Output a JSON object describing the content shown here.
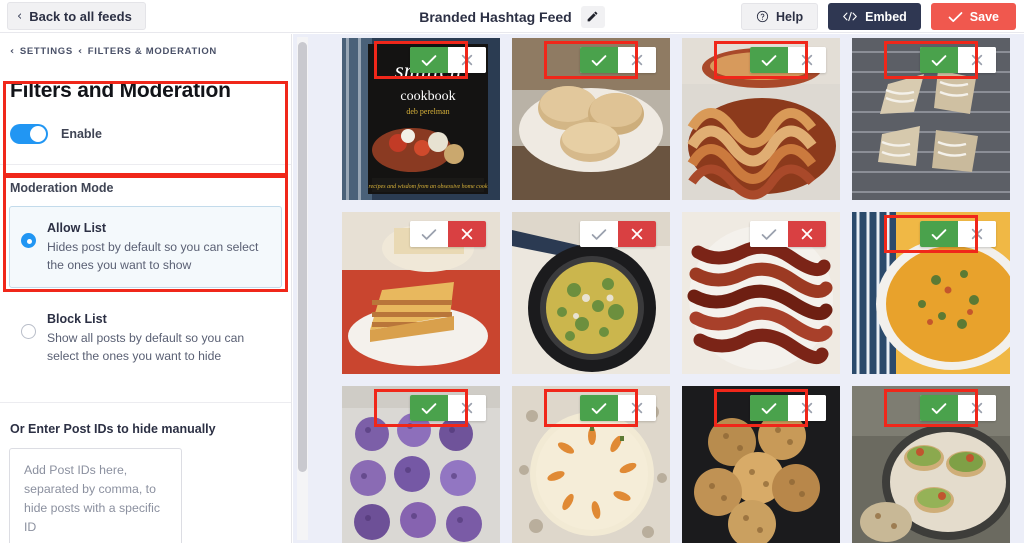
{
  "topbar": {
    "back_label": "Back to all feeds",
    "back_icon": "chevron-left-icon",
    "feed_title": "Branded Hashtag Feed",
    "edit_icon": "pencil-icon",
    "help_label": "Help",
    "help_icon": "question-circle-icon",
    "embed_label": "Embed",
    "embed_icon": "code-brackets-icon",
    "save_label": "Save",
    "save_icon": "check-icon"
  },
  "sidebar": {
    "breadcrumb": {
      "sep_icon": "chevron-left-icon",
      "items": [
        "SETTINGS",
        "FILTERS & MODERATION"
      ]
    },
    "panel_title": "Filters and Moderation",
    "enable": {
      "label": "Enable",
      "state": "on"
    },
    "moderation_mode": {
      "label": "Moderation Mode",
      "options": [
        {
          "title": "Allow List",
          "description": "Hides post by default so you can select the ones you want to show",
          "selected": true
        },
        {
          "title": "Block List",
          "description": "Show all posts by default so you can select the ones you want to hide",
          "selected": false
        }
      ]
    },
    "post_ids": {
      "label": "Or Enter Post IDs to hide manually",
      "value": "",
      "placeholder": "Add Post IDs here, separated by comma, to hide posts with a specific ID"
    }
  },
  "moderation_grid": {
    "check_icon": "check-icon",
    "x_icon": "close-x-icon",
    "columns": 4,
    "posts": [
      {
        "id": 1,
        "caption": "smitten kitchen cookbook",
        "state": "allowed",
        "annotated": true,
        "palette": [
          "#1c1b19",
          "#2a2d38",
          "#c23b26",
          "#d8d3c6"
        ]
      },
      {
        "id": 2,
        "caption": "biscuits on plate",
        "state": "allowed",
        "annotated": true,
        "palette": [
          "#d9c6a6",
          "#c5a575",
          "#efe8df",
          "#8a6a46"
        ]
      },
      {
        "id": 3,
        "caption": "babka swirl loaf",
        "state": "allowed",
        "annotated": true,
        "palette": [
          "#d9d6d1",
          "#a9492a",
          "#e0b47a",
          "#7a3318"
        ]
      },
      {
        "id": 4,
        "caption": "scones with icing on rack",
        "state": "allowed",
        "annotated": true,
        "palette": [
          "#5e6167",
          "#e8e2d6",
          "#c9bda8",
          "#3c3f45"
        ]
      },
      {
        "id": 5,
        "caption": "layer cake slice",
        "state": "blocked",
        "annotated": false,
        "palette": [
          "#c94a3b",
          "#e8c98d",
          "#f2efe8",
          "#8d3b2c"
        ]
      },
      {
        "id": 6,
        "caption": "skillet frittata with herbs",
        "state": "blocked",
        "annotated": false,
        "palette": [
          "#1d1d1f",
          "#cbbb4d",
          "#6c8f3e",
          "#2a2b2e"
        ]
      },
      {
        "id": 7,
        "caption": "candied bacon strips",
        "state": "blocked",
        "annotated": false,
        "palette": [
          "#f0ece6",
          "#7b2417",
          "#a8402a",
          "#5a1a10"
        ]
      },
      {
        "id": 8,
        "caption": "butternut squash soup bowl",
        "state": "allowed",
        "annotated": true,
        "palette": [
          "#2b4a6b",
          "#e8a22c",
          "#f0b845",
          "#4a7a3b"
        ]
      },
      {
        "id": 9,
        "caption": "ube cookies on sheet pan",
        "state": "allowed",
        "annotated": true,
        "palette": [
          "#dad8d4",
          "#7c5fa8",
          "#a487c9",
          "#5c4482"
        ]
      },
      {
        "id": 10,
        "caption": "carrot cake with candy carrots",
        "state": "allowed",
        "annotated": true,
        "palette": [
          "#ded7cb",
          "#f0e4c8",
          "#e08a35",
          "#c4b9a6"
        ]
      },
      {
        "id": 11,
        "caption": "oatmeal cookies stack",
        "state": "allowed",
        "annotated": true,
        "palette": [
          "#1b1b1d",
          "#b88c4e",
          "#d8ab68",
          "#3a3a3c"
        ]
      },
      {
        "id": 12,
        "caption": "avocado toast platter",
        "state": "allowed",
        "annotated": true,
        "palette": [
          "#4a4a46",
          "#7e9c4a",
          "#c0552f",
          "#e0d7c4"
        ]
      }
    ]
  },
  "colors": {
    "accent_red": "#f0584e",
    "annotation_red": "#f0271a",
    "navy": "#2f3752",
    "toggle_blue": "#2196f3",
    "approve_green": "#4aa24c",
    "reject_red": "#d94042",
    "pane_bg": "#eceef8"
  }
}
